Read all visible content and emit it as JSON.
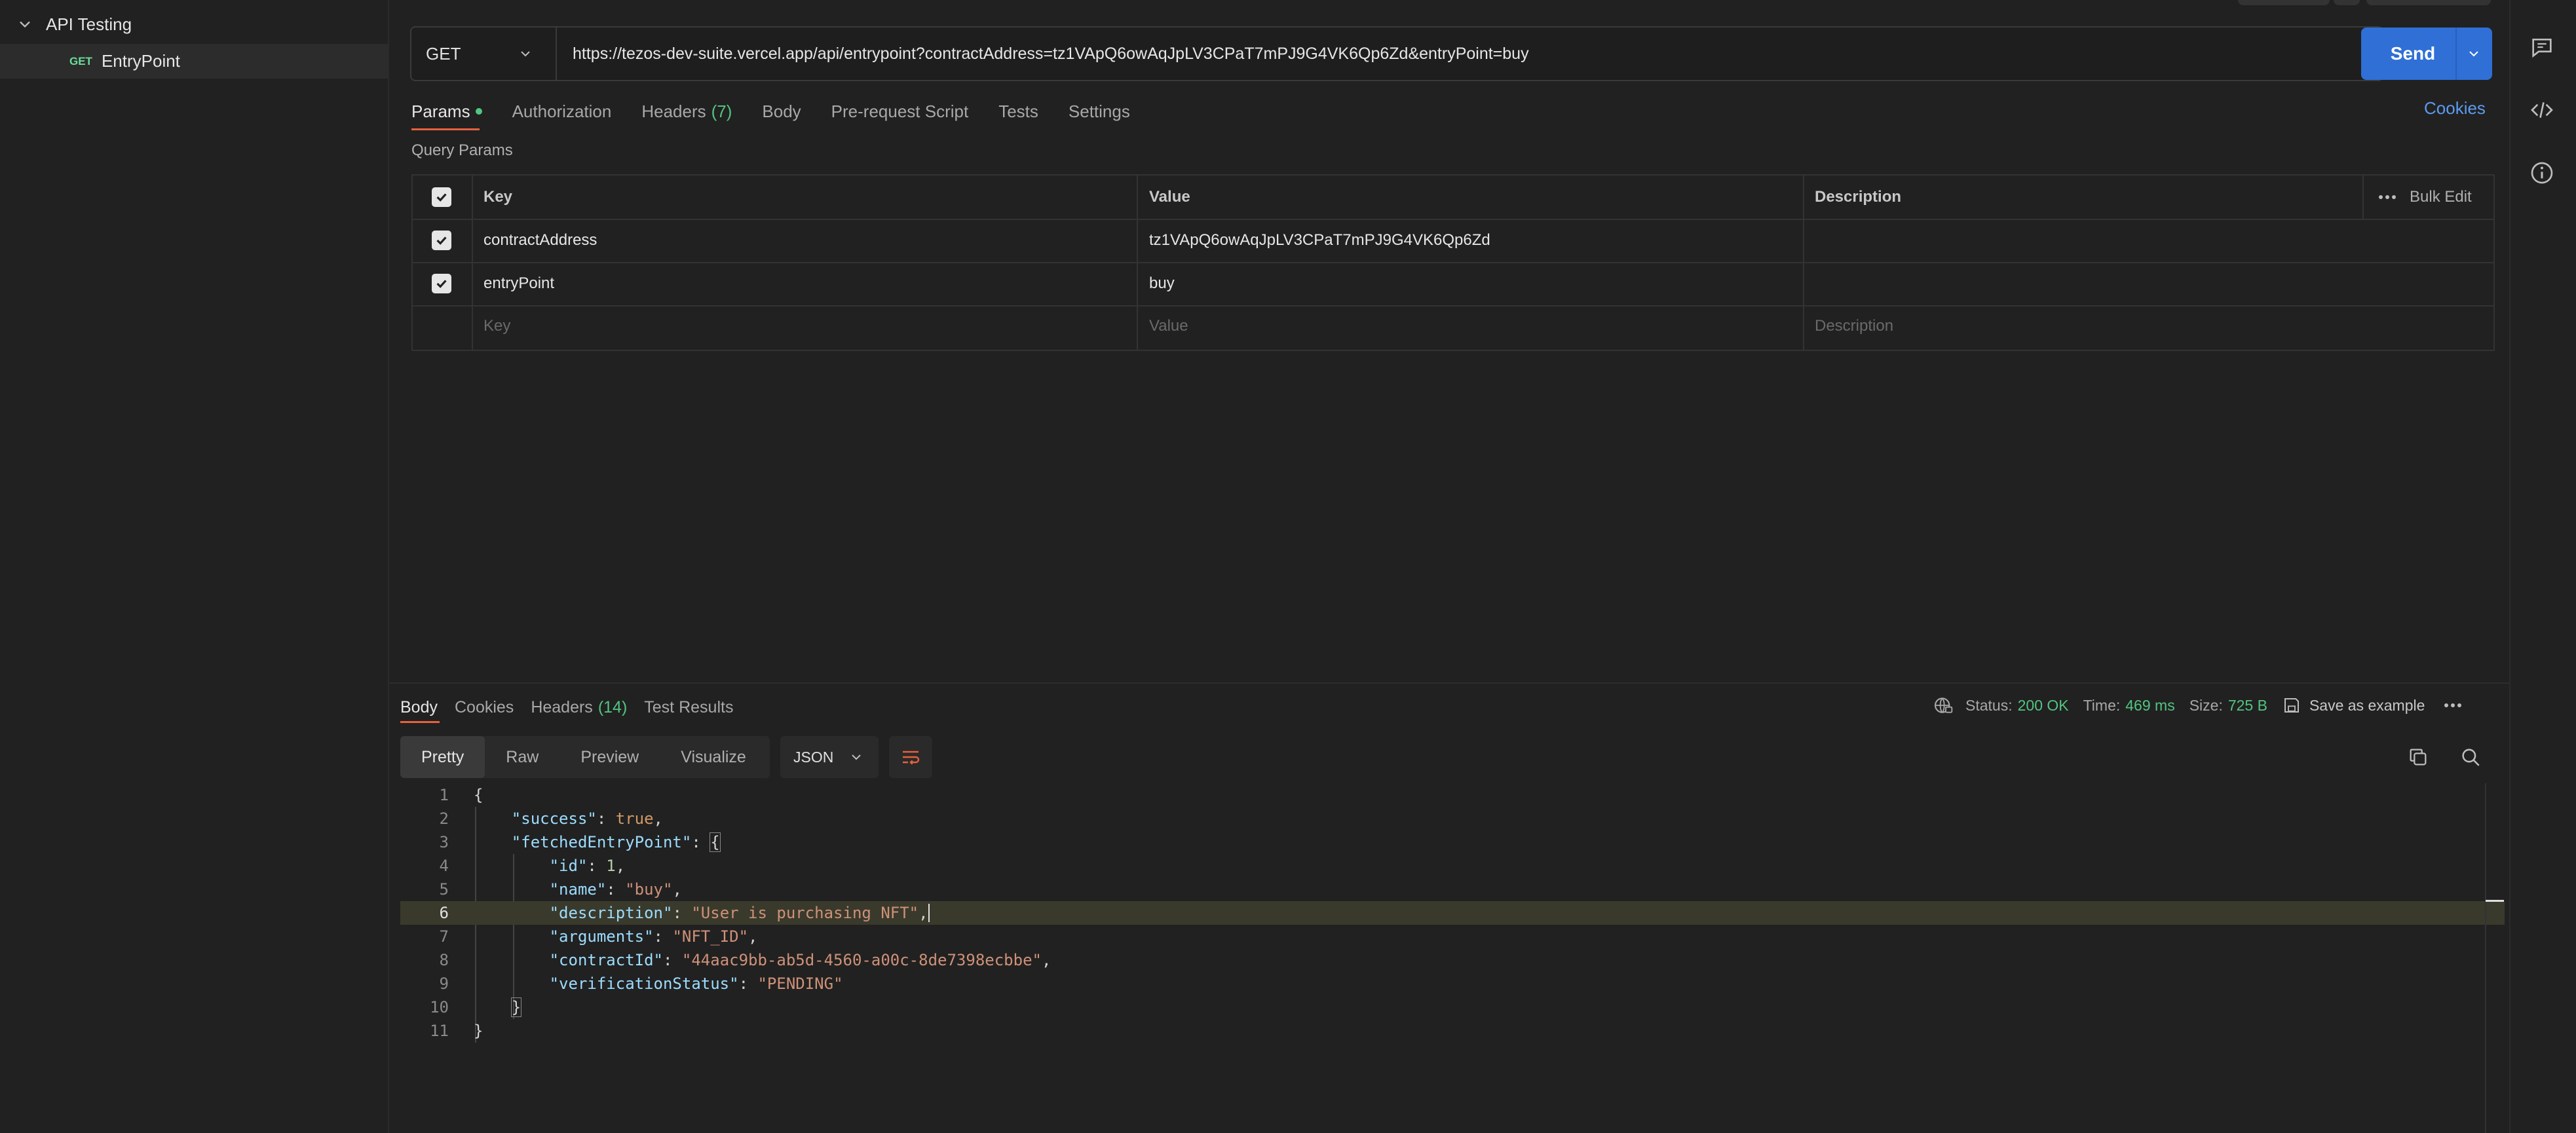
{
  "sidebar": {
    "folder_label": "API Testing",
    "request_method": "GET",
    "request_name": "EntryPoint"
  },
  "request": {
    "method": "GET",
    "url": "https://tezos-dev-suite.vercel.app/api/entrypoint?contractAddress=tz1VApQ6owAqJpLV3CPaT7mPJ9G4VK6Qp6Zd&entryPoint=buy",
    "send_label": "Send",
    "tabs": [
      {
        "label": "Params"
      },
      {
        "label": "Authorization"
      },
      {
        "label": "Headers",
        "count": "(7)"
      },
      {
        "label": "Body"
      },
      {
        "label": "Pre-request Script"
      },
      {
        "label": "Tests"
      },
      {
        "label": "Settings"
      }
    ],
    "cookies_label": "Cookies"
  },
  "query_params": {
    "title": "Query Params",
    "headers": {
      "key": "Key",
      "value": "Value",
      "description": "Description",
      "bulk_edit": "Bulk Edit"
    },
    "rows": [
      {
        "key": "contractAddress",
        "value": "tz1VApQ6owAqJpLV3CPaT7mPJ9G4VK6Qp6Zd",
        "description": ""
      },
      {
        "key": "entryPoint",
        "value": "buy",
        "description": ""
      }
    ],
    "placeholder": {
      "key": "Key",
      "value": "Value",
      "description": "Description"
    }
  },
  "response": {
    "tabs": [
      {
        "label": "Body"
      },
      {
        "label": "Cookies"
      },
      {
        "label": "Headers",
        "count": "(14)"
      },
      {
        "label": "Test Results"
      }
    ],
    "status_label": "Status:",
    "status_value": "200 OK",
    "time_label": "Time:",
    "time_value": "469 ms",
    "size_label": "Size:",
    "size_value": "725 B",
    "save_example": "Save as example",
    "formats": [
      "Pretty",
      "Raw",
      "Preview",
      "Visualize"
    ],
    "language": "JSON",
    "lines": [
      "{",
      "    \"success\": true,",
      "    \"fetchedEntryPoint\": {",
      "        \"id\": 1,",
      "        \"name\": \"buy\",",
      "        \"description\": \"User is purchasing NFT\",",
      "        \"arguments\": \"NFT_ID\",",
      "        \"contractId\": \"44aac9bb-ab5d-4560-a00c-8de7398ecbbe\",",
      "        \"verificationStatus\": \"PENDING\"",
      "    }",
      "}"
    ],
    "current_line": 6
  },
  "colors": {
    "accent": "#2f6fd6",
    "tab_underline": "#e6613d",
    "success": "#52c580"
  }
}
